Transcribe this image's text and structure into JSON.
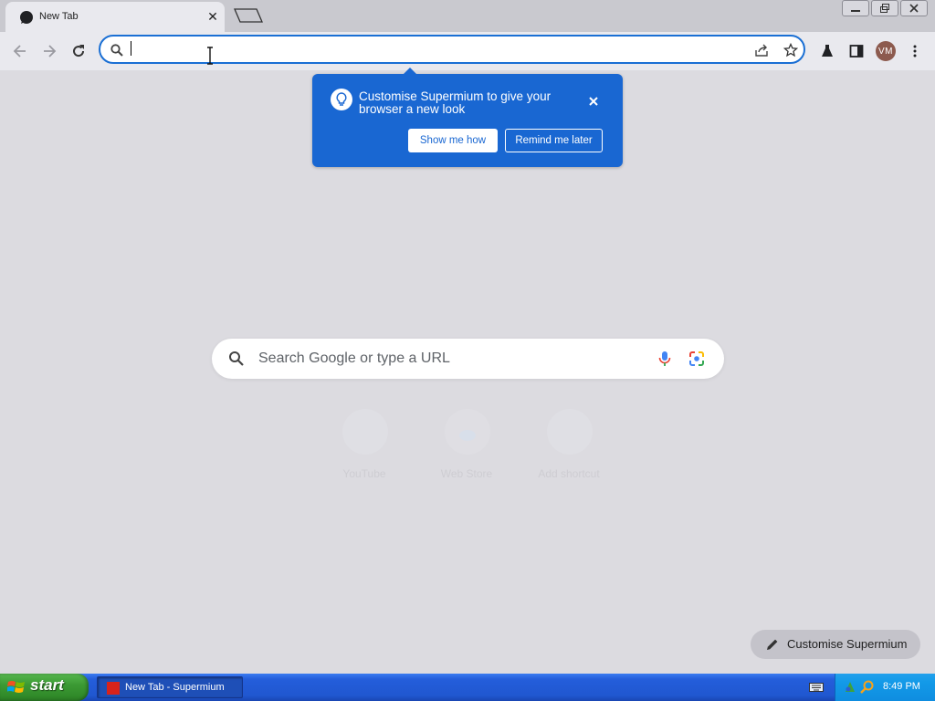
{
  "tab": {
    "title": "New Tab",
    "close_glyph": "✕"
  },
  "toolbar": {
    "omnibox_value": "",
    "avatar_initials": "VM"
  },
  "window_controls": [
    "minimize-icon",
    "restore-icon",
    "close-icon"
  ],
  "promo": {
    "text": "Customise Supermium to give your browser a new look",
    "primary_button": "Show me how",
    "secondary_button": "Remind me later",
    "accent_color": "#1967d2"
  },
  "ntp": {
    "search_placeholder": "Search Google or type a URL",
    "shortcuts": [
      "YouTube",
      "Web Store",
      "Add shortcut"
    ],
    "customise_label": "Customise Supermium"
  },
  "taskbar": {
    "start_label": "start",
    "task_label": "New Tab - Supermium",
    "clock": "8:49 PM"
  }
}
